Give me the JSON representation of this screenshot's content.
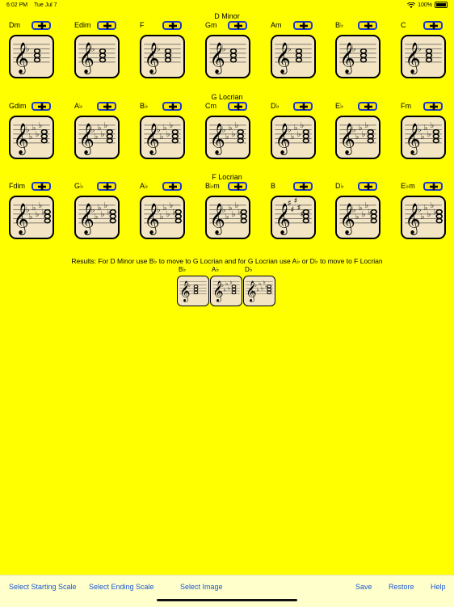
{
  "status_bar": {
    "time": "6:02 PM",
    "date": "Tue Jul 7",
    "battery": "100%"
  },
  "sections": [
    {
      "title": "D Minor",
      "chords": [
        {
          "name": "Dm",
          "flats": 1,
          "sharps": 0
        },
        {
          "name": "Edim",
          "flats": 1,
          "sharps": 0
        },
        {
          "name": "F",
          "flats": 1,
          "sharps": 0
        },
        {
          "name": "Gm",
          "flats": 1,
          "sharps": 0
        },
        {
          "name": "Am",
          "flats": 1,
          "sharps": 0
        },
        {
          "name": "B♭",
          "flats": 1,
          "sharps": 0
        },
        {
          "name": "C",
          "flats": 1,
          "sharps": 0
        }
      ]
    },
    {
      "title": "G Locrian",
      "chords": [
        {
          "name": "Gdim",
          "flats": 5,
          "sharps": 0
        },
        {
          "name": "A♭",
          "flats": 5,
          "sharps": 0
        },
        {
          "name": "B♭",
          "flats": 5,
          "sharps": 0
        },
        {
          "name": "Cm",
          "flats": 5,
          "sharps": 0
        },
        {
          "name": "D♭",
          "flats": 5,
          "sharps": 0
        },
        {
          "name": "E♭",
          "flats": 5,
          "sharps": 0
        },
        {
          "name": "Fm",
          "flats": 5,
          "sharps": 0
        }
      ]
    },
    {
      "title": "F Locrian",
      "chords": [
        {
          "name": "Fdim",
          "flats": 6,
          "sharps": 0
        },
        {
          "name": "G♭",
          "flats": 6,
          "sharps": 0
        },
        {
          "name": "A♭",
          "flats": 6,
          "sharps": 0
        },
        {
          "name": "B♭m",
          "flats": 6,
          "sharps": 0
        },
        {
          "name": "B",
          "flats": 0,
          "sharps": 5
        },
        {
          "name": "D♭",
          "flats": 6,
          "sharps": 0
        },
        {
          "name": "E♭m",
          "flats": 6,
          "sharps": 0
        }
      ]
    }
  ],
  "results": {
    "text": "Results: For D Minor use B♭ to move to G Locrian and for G Locrian use A♭ or D♭ to move to F Locrian",
    "chords": [
      {
        "name": "B♭",
        "flats": 1
      },
      {
        "name": "A♭",
        "flats": 5
      },
      {
        "name": "D♭",
        "flats": 6
      }
    ]
  },
  "toolbar": {
    "select_start": "Select Starting Scale",
    "select_end": "Select Ending Scale",
    "select_image": "Select Image",
    "save": "Save",
    "restore": "Restore",
    "help": "Help"
  },
  "colors": {
    "background": "#ffff00",
    "button_border": "#1b39c9",
    "card": "#f3e5c4",
    "link": "#1a56d6"
  }
}
